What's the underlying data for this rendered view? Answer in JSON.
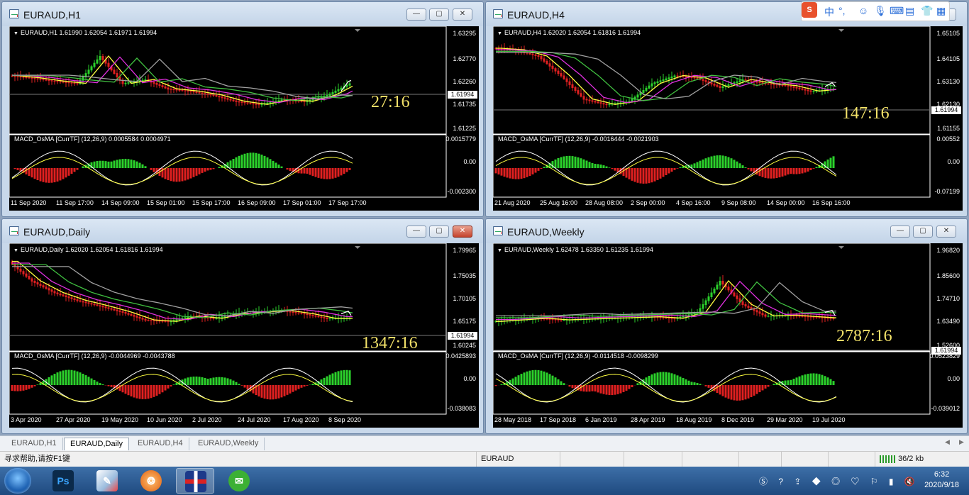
{
  "windows": [
    {
      "title": "EURAUD,H1",
      "ohlc": "EURAUD,H1  1.61990 1.62054 1.61971 1.61994",
      "macd": "MACD_OsMA [CurrTF] (12,26,9) 0.0005584 0.0004971",
      "timer": "27:16",
      "prices": [
        "1.63295",
        "1.62770",
        "1.62260",
        "1.61735",
        "1.61225"
      ],
      "current": "1.61994",
      "macd_scale": [
        "0.0015779",
        "0.00",
        "-0.002300"
      ],
      "times": [
        "11 Sep 2020",
        "11 Sep 17:00",
        "14 Sep 09:00",
        "15 Sep 01:00",
        "15 Sep 17:00",
        "16 Sep 09:00",
        "17 Sep 01:00",
        "17 Sep 17:00"
      ]
    },
    {
      "title": "EURAUD,H4",
      "ohlc": "EURAUD,H4  1.62020 1.62054 1.61816 1.61994",
      "macd": "MACD_OsMA [CurrTF] (12,26,9) -0.0016444 -0.0021903",
      "timer": "147:16",
      "prices": [
        "1.65105",
        "1.64105",
        "1.63130",
        "1.62130",
        "1.61155"
      ],
      "current": "1.61994",
      "macd_scale": [
        "0.00552",
        "0.00",
        "-0.07199"
      ],
      "times": [
        "21 Aug 2020",
        "25 Aug 16:00",
        "28 Aug 08:00",
        "2 Sep 00:00",
        "4 Sep 16:00",
        "9 Sep 08:00",
        "14 Sep 00:00",
        "16 Sep 16:00"
      ]
    },
    {
      "title": "EURAUD,Daily",
      "ohlc": "EURAUD,Daily  1.62020 1.62054 1.61816 1.61994",
      "macd": "MACD_OsMA [CurrTF] (12,26,9) -0.0044969 -0.0043788",
      "timer": "1347:16",
      "prices": [
        "1.79965",
        "1.75035",
        "1.70105",
        "1.65175",
        "1.60245"
      ],
      "current": "1.61994",
      "macd_scale": [
        "0.0425893",
        "0.00",
        "-0.038083"
      ],
      "times": [
        "3 Apr 2020",
        "27 Apr 2020",
        "19 May 2020",
        "10 Jun 2020",
        "2 Jul 2020",
        "24 Jul 2020",
        "17 Aug 2020",
        "8 Sep 2020"
      ]
    },
    {
      "title": "EURAUD,Weekly",
      "ohlc": "EURAUD,Weekly  1.62478 1.63350 1.61235 1.61994",
      "macd": "MACD_OsMA [CurrTF] (12,26,9) -0.0114518 -0.0098299",
      "timer": "2787:16",
      "prices": [
        "1.96820",
        "1.85600",
        "1.74710",
        "1.63490",
        "1.52600"
      ],
      "current": "1.61994",
      "macd_scale": [
        "0.0523829",
        "0.00",
        "-0.039012"
      ],
      "times": [
        "28 May 2018",
        "17 Sep 2018",
        "6 Jan 2019",
        "28 Apr 2019",
        "18 Aug 2019",
        "8 Dec 2019",
        "29 Mar 2020",
        "19 Jul 2020"
      ]
    }
  ],
  "tabs": [
    "EURAUD,H1",
    "EURAUD,Daily",
    "EURAUD,H4",
    "EURAUD,Weekly"
  ],
  "active_tab": "EURAUD,Daily",
  "status": {
    "help": "寻求帮助,请按F1键",
    "profile": "EURAUD",
    "traffic": "36/2 kb"
  },
  "clock": {
    "time": "6:32",
    "date": "2020/9/18"
  },
  "ime": {
    "lang": "中",
    "punct": "°,"
  },
  "taskbar_apps": [
    "windows-start",
    "photoshop",
    "paint",
    "browser",
    "metatrader",
    "wechat"
  ],
  "colors": {
    "bull": "#2bd12b",
    "bear": "#e02020",
    "ma_yellow": "#ffff40",
    "ma_magenta": "#e030e0",
    "ma_green": "#40c040",
    "ma_gray": "#a0a0a0",
    "timer": "#f4e36a"
  }
}
